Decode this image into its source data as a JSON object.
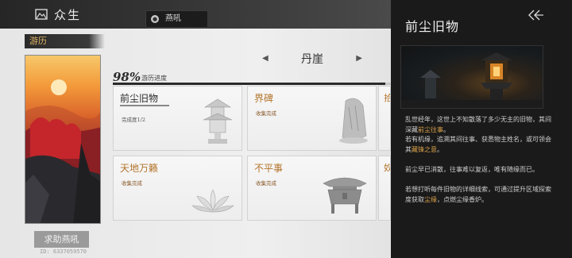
{
  "header": {
    "title": "众生",
    "chip_label": "燕吼",
    "chip_icon": "circle-badge-icon"
  },
  "left": {
    "travel_tag": "游历",
    "help_button": "求助燕吼",
    "uid": "ID: 6337059570"
  },
  "region": {
    "name": "丹崖",
    "prev_icon": "caret-left-icon",
    "next_icon": "caret-right-icon"
  },
  "progress": {
    "percent_text": "98%",
    "label": "游历进度",
    "value": 0.98
  },
  "cards": [
    {
      "title": "前尘旧物",
      "subtitle": "完成度1/2",
      "style": "dark",
      "icon": "pagoda-lantern-icon"
    },
    {
      "title": "界碑",
      "subtitle": "收集完成",
      "style": "gold",
      "icon": "stone-stele-icon"
    },
    {
      "title": "天地万籁",
      "subtitle": "收集完成",
      "style": "gold",
      "icon": "lotus-icon"
    },
    {
      "title": "不平事",
      "subtitle": "收集完成",
      "style": "gold",
      "icon": "bronze-censer-icon"
    }
  ],
  "partial_cards": [
    "拾",
    "奴"
  ],
  "detail": {
    "title": "前尘旧物",
    "back_icon": "double-chevron-left-icon",
    "p1_a": "乱世经年，这世上不知散落了多少无主的旧物，其间深藏",
    "p1_hl": "前尘往事",
    "p1_b": "。",
    "p2_a": "若有机缘，追溯其间往事、获悉物主姓名，或可领会其",
    "p2_hl": "藏锋之意",
    "p2_b": "。",
    "p3": "前尘早已消散，往事难以复返，唯有随缘而已。",
    "p4_a": "若想打听每件旧物的详细线索，可通过提升区域探索度获取",
    "p4_hl": "尘缘",
    "p4_b": "，点燃尘缘香炉。"
  }
}
